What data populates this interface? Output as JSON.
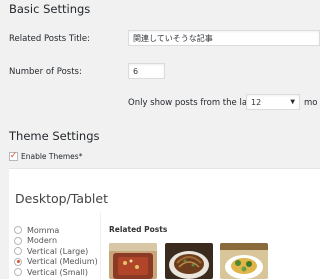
{
  "basic_settings": {
    "heading": "Basic Settings",
    "related_posts_title_label": "Related Posts Title:",
    "related_posts_title_value": "関連していそうな記事",
    "number_of_posts_label": "Number of Posts:",
    "number_of_posts_value": "6",
    "show_posts_from_label": "Only show posts from the last",
    "show_posts_from_value": "12",
    "show_posts_from_unit": "mo"
  },
  "theme_settings": {
    "heading": "Theme Settings",
    "enable_themes_label": "Enable Themes*",
    "enable_themes_checked": true
  },
  "preview": {
    "heading": "Desktop/Tablet",
    "themes": [
      {
        "label": "Momma",
        "selected": false
      },
      {
        "label": "Modern",
        "selected": false
      },
      {
        "label": "Vertical (Large)",
        "selected": false
      },
      {
        "label": "Vertical (Medium)",
        "selected": true
      },
      {
        "label": "Vertical (Small)",
        "selected": false
      }
    ],
    "related_posts_heading": "Related Posts",
    "thumbnails": [
      "food-photo-1",
      "food-photo-2",
      "food-photo-3"
    ]
  },
  "colors": {
    "page_bg": "#f1f1f1",
    "accent": "#e04a2f"
  }
}
